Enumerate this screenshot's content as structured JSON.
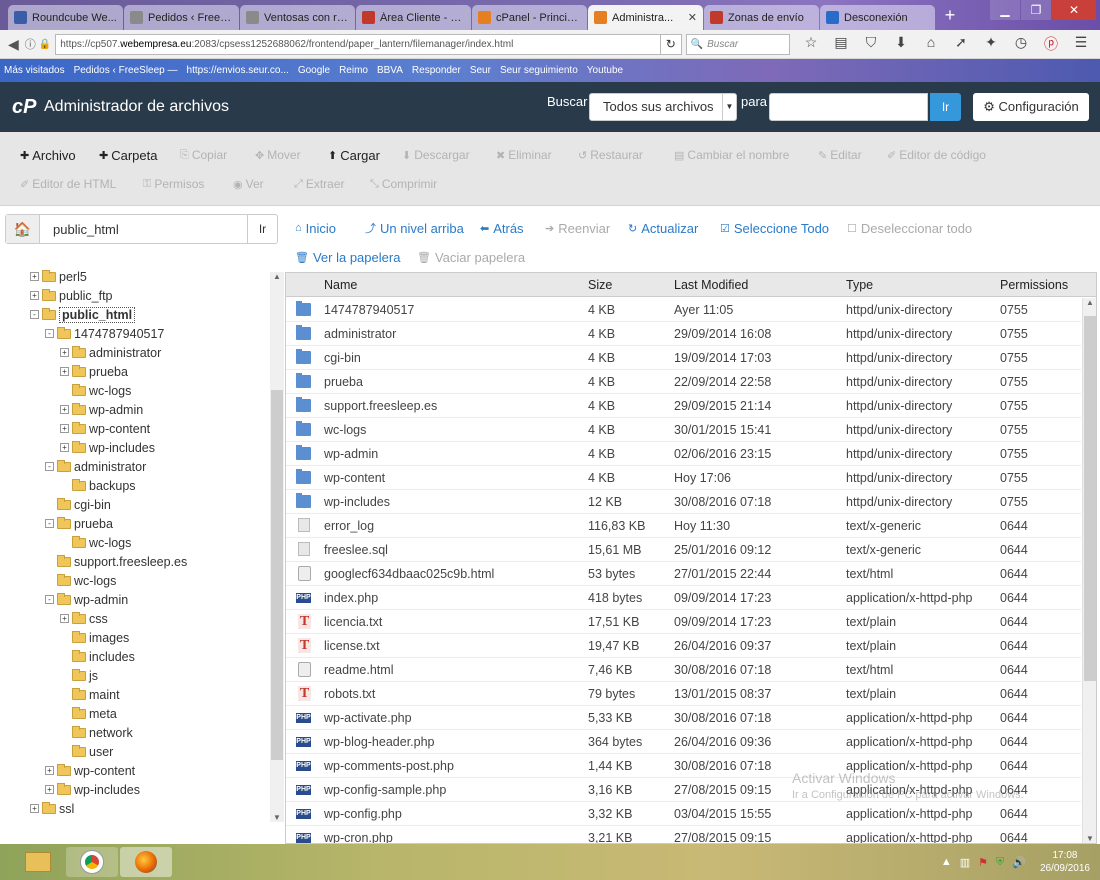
{
  "browser": {
    "tabs": [
      {
        "label": "Roundcube We...",
        "color": "#3a5da8"
      },
      {
        "label": "Pedidos ‹ FreeSleep ...",
        "color": "#8a8a8a"
      },
      {
        "label": "Ventosas con rosca ...",
        "color": "#8a8a8a"
      },
      {
        "label": "Área Cliente - W...",
        "color": "#c0392b"
      },
      {
        "label": "cPanel - Principal",
        "color": "#e67e22"
      },
      {
        "label": "Administra...",
        "color": "#e67e22",
        "active": true
      },
      {
        "label": "Zonas de envío",
        "color": "#c0392b"
      },
      {
        "label": "Desconexión",
        "color": "#2a6bc7"
      }
    ],
    "url_prefix": "https://cp507.",
    "url_host": "webempresa.eu",
    "url_rest": ":2083/cpsess1252688062/frontend/paper_lantern/filemanager/index.html",
    "search_placeholder": "Buscar",
    "bookmarks": [
      "Más visitados",
      "Pedidos ‹ FreeSleep —",
      "https://envios.seur.co...",
      "Google",
      "Reimo",
      "BBVA",
      "Responder",
      "Seur",
      "Seur seguimiento",
      "Youtube"
    ]
  },
  "cpanel": {
    "logo": "cP",
    "title": "Administrador de archivos",
    "search_label": "Buscar",
    "search_scope": "Todos sus archivos",
    "para_label": "para",
    "go_label": "Ir",
    "config_label": "Configuración"
  },
  "toolbar": {
    "row1": [
      {
        "icon": "✚",
        "label": "Archivo",
        "on": true
      },
      {
        "icon": "✚",
        "label": "Carpeta",
        "on": true
      },
      {
        "icon": "⎘",
        "label": "Copiar",
        "on": false
      },
      {
        "icon": "✥",
        "label": "Mover",
        "on": false
      },
      {
        "icon": "⬆",
        "label": "Cargar",
        "on": true
      },
      {
        "icon": "⬇",
        "label": "Descargar",
        "on": false
      },
      {
        "icon": "✖",
        "label": "Eliminar",
        "on": false
      },
      {
        "icon": "↺",
        "label": "Restaurar",
        "on": false
      },
      {
        "icon": "▤",
        "label": "Cambiar el nombre",
        "on": false
      },
      {
        "icon": "✎",
        "label": "Editar",
        "on": false
      },
      {
        "icon": "✐",
        "label": "Editor de código",
        "on": false
      }
    ],
    "row2": [
      {
        "icon": "✐",
        "label": "Editor de HTML",
        "on": false
      },
      {
        "icon": "⚿",
        "label": "Permisos",
        "on": false
      },
      {
        "icon": "◉",
        "label": "Ver",
        "on": false
      },
      {
        "icon": "⤢",
        "label": "Extraer",
        "on": false
      },
      {
        "icon": "⤡",
        "label": "Comprimir",
        "on": false
      }
    ]
  },
  "path": {
    "value": "public_html",
    "go_label": "Ir"
  },
  "tree": [
    {
      "label": "perl5",
      "level": 0,
      "pm": "+"
    },
    {
      "label": "public_ftp",
      "level": 0,
      "pm": "+"
    },
    {
      "label": "public_html",
      "level": 0,
      "pm": "-",
      "selected": true
    },
    {
      "label": "1474787940517",
      "level": 1,
      "pm": "-"
    },
    {
      "label": "administrator",
      "level": 2,
      "pm": "+"
    },
    {
      "label": "prueba",
      "level": 2,
      "pm": "+"
    },
    {
      "label": "wc-logs",
      "level": 2,
      "pm": ""
    },
    {
      "label": "wp-admin",
      "level": 2,
      "pm": "+"
    },
    {
      "label": "wp-content",
      "level": 2,
      "pm": "+"
    },
    {
      "label": "wp-includes",
      "level": 2,
      "pm": "+"
    },
    {
      "label": "administrator",
      "level": 1,
      "pm": "-"
    },
    {
      "label": "backups",
      "level": 2,
      "pm": ""
    },
    {
      "label": "cgi-bin",
      "level": 1,
      "pm": ""
    },
    {
      "label": "prueba",
      "level": 1,
      "pm": "-"
    },
    {
      "label": "wc-logs",
      "level": 2,
      "pm": ""
    },
    {
      "label": "support.freesleep.es",
      "level": 1,
      "pm": ""
    },
    {
      "label": "wc-logs",
      "level": 1,
      "pm": ""
    },
    {
      "label": "wp-admin",
      "level": 1,
      "pm": "-"
    },
    {
      "label": "css",
      "level": 2,
      "pm": "+"
    },
    {
      "label": "images",
      "level": 2,
      "pm": ""
    },
    {
      "label": "includes",
      "level": 2,
      "pm": ""
    },
    {
      "label": "js",
      "level": 2,
      "pm": ""
    },
    {
      "label": "maint",
      "level": 2,
      "pm": ""
    },
    {
      "label": "meta",
      "level": 2,
      "pm": ""
    },
    {
      "label": "network",
      "level": 2,
      "pm": ""
    },
    {
      "label": "user",
      "level": 2,
      "pm": ""
    },
    {
      "label": "wp-content",
      "level": 1,
      "pm": "+"
    },
    {
      "label": "wp-includes",
      "level": 1,
      "pm": "+"
    },
    {
      "label": "ssl",
      "level": 0,
      "pm": "+"
    }
  ],
  "nav": {
    "row1": [
      {
        "icon": "⌂",
        "label": "Inicio",
        "dis": false
      },
      {
        "icon": "⤴",
        "label": "Un nivel arriba",
        "dis": false
      },
      {
        "icon": "⬅",
        "label": "Atrás",
        "dis": false
      },
      {
        "icon": "➔",
        "label": "Reenviar",
        "dis": true
      },
      {
        "icon": "↻",
        "label": "Actualizar",
        "dis": false
      },
      {
        "icon": "☑",
        "label": "Seleccione Todo",
        "dis": false
      },
      {
        "icon": "☐",
        "label": "Deseleccionar todo",
        "dis": true
      }
    ],
    "row2": [
      {
        "icon": "🗑",
        "label": "Ver la papelera",
        "dis": false
      },
      {
        "icon": "🗑",
        "label": "Vaciar papelera",
        "dis": true
      }
    ]
  },
  "table": {
    "headers": [
      "Name",
      "Size",
      "Last Modified",
      "Type",
      "Permissions"
    ],
    "rows": [
      {
        "icon": "dir",
        "name": "1474787940517",
        "size": "4 KB",
        "modified": "Ayer 11:05",
        "type": "httpd/unix-directory",
        "perm": "0755"
      },
      {
        "icon": "dir",
        "name": "administrator",
        "size": "4 KB",
        "modified": "29/09/2014 16:08",
        "type": "httpd/unix-directory",
        "perm": "0755"
      },
      {
        "icon": "dir",
        "name": "cgi-bin",
        "size": "4 KB",
        "modified": "19/09/2014 17:03",
        "type": "httpd/unix-directory",
        "perm": "0755"
      },
      {
        "icon": "dir",
        "name": "prueba",
        "size": "4 KB",
        "modified": "22/09/2014 22:58",
        "type": "httpd/unix-directory",
        "perm": "0755"
      },
      {
        "icon": "dir",
        "name": "support.freesleep.es",
        "size": "4 KB",
        "modified": "29/09/2015 21:14",
        "type": "httpd/unix-directory",
        "perm": "0755"
      },
      {
        "icon": "dir",
        "name": "wc-logs",
        "size": "4 KB",
        "modified": "30/01/2015 15:41",
        "type": "httpd/unix-directory",
        "perm": "0755"
      },
      {
        "icon": "dir",
        "name": "wp-admin",
        "size": "4 KB",
        "modified": "02/06/2016 23:15",
        "type": "httpd/unix-directory",
        "perm": "0755"
      },
      {
        "icon": "dir",
        "name": "wp-content",
        "size": "4 KB",
        "modified": "Hoy 17:06",
        "type": "httpd/unix-directory",
        "perm": "0755"
      },
      {
        "icon": "dir",
        "name": "wp-includes",
        "size": "12 KB",
        "modified": "30/08/2016 07:18",
        "type": "httpd/unix-directory",
        "perm": "0755"
      },
      {
        "icon": "gen",
        "name": "error_log",
        "size": "116,83 KB",
        "modified": "Hoy 11:30",
        "type": "text/x-generic",
        "perm": "0644"
      },
      {
        "icon": "gen",
        "name": "freeslee.sql",
        "size": "15,61 MB",
        "modified": "25/01/2016 09:12",
        "type": "text/x-generic",
        "perm": "0644"
      },
      {
        "icon": "html",
        "name": "googlecf634dbaac025c9b.html",
        "size": "53 bytes",
        "modified": "27/01/2015 22:44",
        "type": "text/html",
        "perm": "0644"
      },
      {
        "icon": "php",
        "name": "index.php",
        "size": "418 bytes",
        "modified": "09/09/2014 17:23",
        "type": "application/x-httpd-php",
        "perm": "0644"
      },
      {
        "icon": "txt",
        "name": "licencia.txt",
        "size": "17,51 KB",
        "modified": "09/09/2014 17:23",
        "type": "text/plain",
        "perm": "0644"
      },
      {
        "icon": "txt",
        "name": "license.txt",
        "size": "19,47 KB",
        "modified": "26/04/2016 09:37",
        "type": "text/plain",
        "perm": "0644"
      },
      {
        "icon": "html",
        "name": "readme.html",
        "size": "7,46 KB",
        "modified": "30/08/2016 07:18",
        "type": "text/html",
        "perm": "0644"
      },
      {
        "icon": "txt",
        "name": "robots.txt",
        "size": "79 bytes",
        "modified": "13/01/2015 08:37",
        "type": "text/plain",
        "perm": "0644"
      },
      {
        "icon": "php",
        "name": "wp-activate.php",
        "size": "5,33 KB",
        "modified": "30/08/2016 07:18",
        "type": "application/x-httpd-php",
        "perm": "0644"
      },
      {
        "icon": "php",
        "name": "wp-blog-header.php",
        "size": "364 bytes",
        "modified": "26/04/2016 09:36",
        "type": "application/x-httpd-php",
        "perm": "0644"
      },
      {
        "icon": "php",
        "name": "wp-comments-post.php",
        "size": "1,44 KB",
        "modified": "30/08/2016 07:18",
        "type": "application/x-httpd-php",
        "perm": "0644"
      },
      {
        "icon": "php",
        "name": "wp-config-sample.php",
        "size": "3,16 KB",
        "modified": "27/08/2015 09:15",
        "type": "application/x-httpd-php",
        "perm": "0644"
      },
      {
        "icon": "php",
        "name": "wp-config.php",
        "size": "3,32 KB",
        "modified": "03/04/2015 15:55",
        "type": "application/x-httpd-php",
        "perm": "0644"
      },
      {
        "icon": "php",
        "name": "wp-cron.php",
        "size": "3,21 KB",
        "modified": "27/08/2015 09:15",
        "type": "application/x-httpd-php",
        "perm": "0644"
      }
    ]
  },
  "watermark": {
    "title": "Activar Windows",
    "sub": "Ir a Configuración de PC para activar Windows."
  },
  "taskbar": {
    "time": "17:08",
    "date": "26/09/2016"
  }
}
